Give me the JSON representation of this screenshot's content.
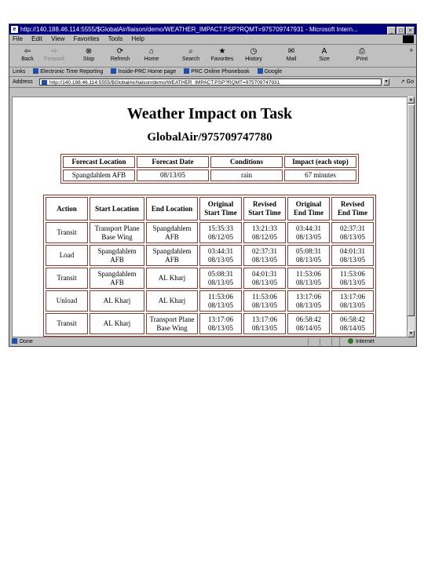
{
  "window": {
    "title": "http://140.188.46.114:5555/$GlobalAir/liaison/demo/WEATHER_IMPACT.PSP?RQMT=975709747931 - Microsoft Intern...",
    "min_glyph": "_",
    "max_glyph": "□",
    "close_glyph": "×"
  },
  "menu": [
    "File",
    "Edit",
    "View",
    "Favorites",
    "Tools",
    "Help"
  ],
  "toolbar": [
    {
      "label": "Back",
      "glyph": "⇦"
    },
    {
      "label": "Forward",
      "glyph": "⇨"
    },
    {
      "label": "Stop",
      "glyph": "⊗"
    },
    {
      "label": "Refresh",
      "glyph": "⟳"
    },
    {
      "label": "Home",
      "glyph": "⌂"
    },
    {
      "label": "Search",
      "glyph": "⌕"
    },
    {
      "label": "Favorites",
      "glyph": "★"
    },
    {
      "label": "History",
      "glyph": "◷"
    },
    {
      "label": "Mail",
      "glyph": "✉"
    },
    {
      "label": "Size",
      "glyph": "A"
    },
    {
      "label": "Print",
      "glyph": "⎙"
    }
  ],
  "toolbar_more": "»",
  "links": {
    "label": "Links",
    "items": [
      "Electronic Time Reporting",
      "Inside-PRC Home page",
      "PRC Online Phonebook",
      "Google"
    ]
  },
  "address": {
    "label": "Address",
    "url": "http://140.188.46.114:5555/$GlobalAir/liaison/demo/WEATHER_IMPACT.PSP?RQMT=975709747931",
    "go_label": "Go"
  },
  "page": {
    "title": "Weather Impact on Task",
    "subtitle": "GlobalAir/975709747780"
  },
  "summary": {
    "headers": [
      "Forecast Location",
      "Forecast Date",
      "Conditions",
      "Impact (each stop)"
    ],
    "row": [
      "Spangdahlem AFB",
      "08/13/05",
      "rain",
      "67 minutes"
    ]
  },
  "stops": {
    "headers": [
      "Action",
      "Start Location",
      "End Location",
      "Original Start Time",
      "Revised Start Time",
      "Original End Time",
      "Revised End Time"
    ],
    "rows": [
      [
        "Transit",
        "Transport Plane Base Wing",
        "Spangdahlem AFB",
        "15:35:33 08/12/05",
        "13:21:33 08/12/05",
        "03:44:31 08/13/05",
        "02:37:31 08/13/05"
      ],
      [
        "Load",
        "Spangdahlem AFB",
        "Spangdahlem AFB",
        "03:44:31 08/13/05",
        "02:37:31 08/13/05",
        "05:08:31 08/13/05",
        "04:01:31 08/13/05"
      ],
      [
        "Transit",
        "Spangdahlem AFB",
        "AL Kharj",
        "05:08:31 08/13/05",
        "04:01:31 08/13/05",
        "11:53:06 08/13/05",
        "11:53:06 08/13/05"
      ],
      [
        "Unload",
        "AL Kharj",
        "AL Kharj",
        "11:53:06 08/13/05",
        "11:53:06 08/13/05",
        "13:17:06 08/13/05",
        "13:17:06 08/13/05"
      ],
      [
        "Transit",
        "AL Kharj",
        "Transport Plane Base Wing",
        "13:17:06 08/13/05",
        "13:17:06 08/13/05",
        "06:58:42 08/14/05",
        "06:58:42 08/14/05"
      ]
    ]
  },
  "status": {
    "text": "Done",
    "zone": "Internet"
  }
}
